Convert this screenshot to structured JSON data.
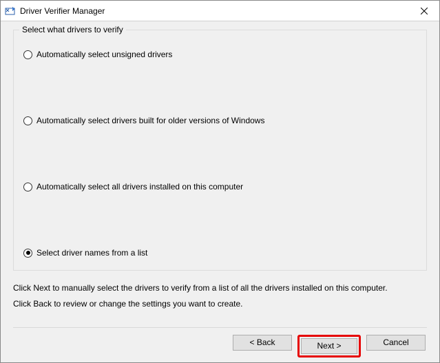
{
  "window": {
    "title": "Driver Verifier Manager"
  },
  "groupbox": {
    "title": "Select what drivers to verify",
    "options": [
      {
        "label": "Automatically select unsigned drivers",
        "checked": false
      },
      {
        "label": "Automatically select drivers built for older versions of Windows",
        "checked": false
      },
      {
        "label": "Automatically select all drivers installed on this computer",
        "checked": false
      },
      {
        "label": "Select driver names from a list",
        "checked": true
      }
    ]
  },
  "info": {
    "line1": "Click Next to manually select the drivers to verify from a list of all the drivers installed on this computer.",
    "line2": "Click Back to review or change the settings you want to create."
  },
  "buttons": {
    "back": "< Back",
    "next": "Next >",
    "cancel": "Cancel"
  }
}
